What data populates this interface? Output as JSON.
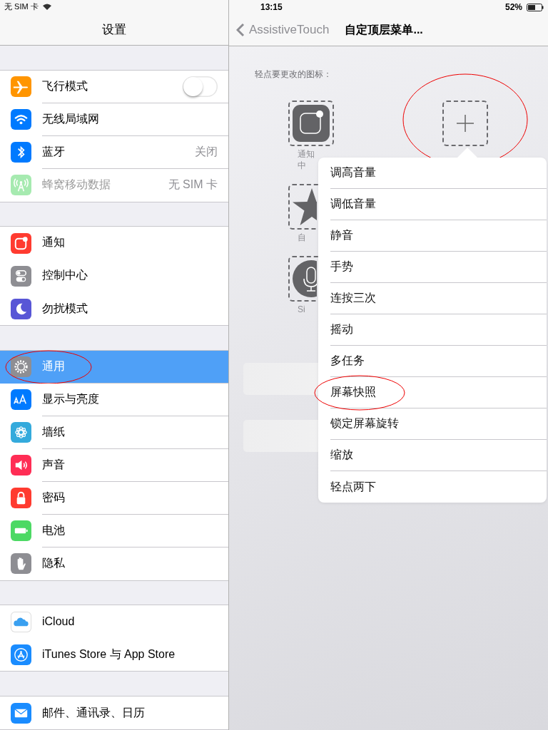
{
  "status_bar": {
    "carrier": "无 SIM 卡",
    "time": "13:15",
    "battery": "52%"
  },
  "sidebar": {
    "title": "设置",
    "groups": [
      {
        "items": [
          {
            "label": "飞行模式",
            "color": "#ff9500",
            "kind": "toggle",
            "on": false,
            "selected": false,
            "disabled": false,
            "circled": false
          },
          {
            "label": "无线局域网",
            "color": "#007aff",
            "kind": "plain",
            "selected": false,
            "disabled": false,
            "circled": false
          },
          {
            "label": "蓝牙",
            "color": "#007aff",
            "kind": "value",
            "value": "关闭",
            "selected": false,
            "disabled": false,
            "circled": false
          },
          {
            "label": "蜂窝移动数据",
            "color": "#a6eab0",
            "kind": "value",
            "value": "无 SIM 卡",
            "selected": false,
            "disabled": true,
            "circled": false
          }
        ]
      },
      {
        "items": [
          {
            "label": "通知",
            "color": "#ff3b30",
            "kind": "plain",
            "selected": false,
            "disabled": false,
            "circled": false
          },
          {
            "label": "控制中心",
            "color": "#8e8e93",
            "kind": "plain",
            "selected": false,
            "disabled": false,
            "circled": false
          },
          {
            "label": "勿扰模式",
            "color": "#5856d6",
            "kind": "plain",
            "selected": false,
            "disabled": false,
            "circled": false
          }
        ]
      },
      {
        "items": [
          {
            "label": "通用",
            "color": "#8e8e93",
            "kind": "plain",
            "selected": true,
            "disabled": false,
            "circled": true
          },
          {
            "label": "显示与亮度",
            "color": "#007aff",
            "kind": "plain",
            "selected": false,
            "disabled": false,
            "circled": false
          },
          {
            "label": "墙纸",
            "color": "#34aadc",
            "kind": "plain",
            "selected": false,
            "disabled": false,
            "circled": false
          },
          {
            "label": "声音",
            "color": "#ff2d55",
            "kind": "plain",
            "selected": false,
            "disabled": false,
            "circled": false
          },
          {
            "label": "密码",
            "color": "#ff3b30",
            "kind": "plain",
            "selected": false,
            "disabled": false,
            "circled": false
          },
          {
            "label": "电池",
            "color": "#4cd964",
            "kind": "plain",
            "selected": false,
            "disabled": false,
            "circled": false
          },
          {
            "label": "隐私",
            "color": "#8e8e93",
            "kind": "plain",
            "selected": false,
            "disabled": false,
            "circled": false
          }
        ]
      },
      {
        "items": [
          {
            "label": "iCloud",
            "color": "#ffffff",
            "kind": "plain",
            "selected": false,
            "disabled": false,
            "circled": false
          },
          {
            "label": "iTunes Store 与 App Store",
            "color": "#1a8cff",
            "kind": "plain",
            "selected": false,
            "disabled": false,
            "circled": false
          }
        ]
      },
      {
        "items": [
          {
            "label": "邮件、通讯录、日历",
            "color": "#1a8cff",
            "kind": "plain",
            "selected": false,
            "disabled": false,
            "circled": false
          }
        ]
      }
    ]
  },
  "detail": {
    "back": "AssistiveTouch",
    "title": "自定顶层菜单...",
    "hint": "轻点要更改的图标：",
    "slot_rows": [
      [
        {
          "kind": "notification-center",
          "label": [
            "通知",
            "中"
          ],
          "circled": false
        },
        {
          "kind": "add",
          "circled": true
        }
      ],
      [
        {
          "kind": "star",
          "label": [
            "自"
          ],
          "circled": false
        }
      ],
      [
        {
          "kind": "siri",
          "label": [
            "Si"
          ],
          "circled": false
        }
      ]
    ],
    "menu": [
      {
        "label": "调高音量",
        "circled": false
      },
      {
        "label": "调低音量",
        "circled": false
      },
      {
        "label": "静音",
        "circled": false
      },
      {
        "label": "手势",
        "circled": false
      },
      {
        "label": "连按三次",
        "circled": false
      },
      {
        "label": "摇动",
        "circled": false
      },
      {
        "label": "多任务",
        "circled": false
      },
      {
        "label": "屏幕快照",
        "circled": true
      },
      {
        "label": "锁定屏幕旋转",
        "circled": false
      },
      {
        "label": "缩放",
        "circled": false
      },
      {
        "label": "轻点两下",
        "circled": false
      }
    ]
  }
}
